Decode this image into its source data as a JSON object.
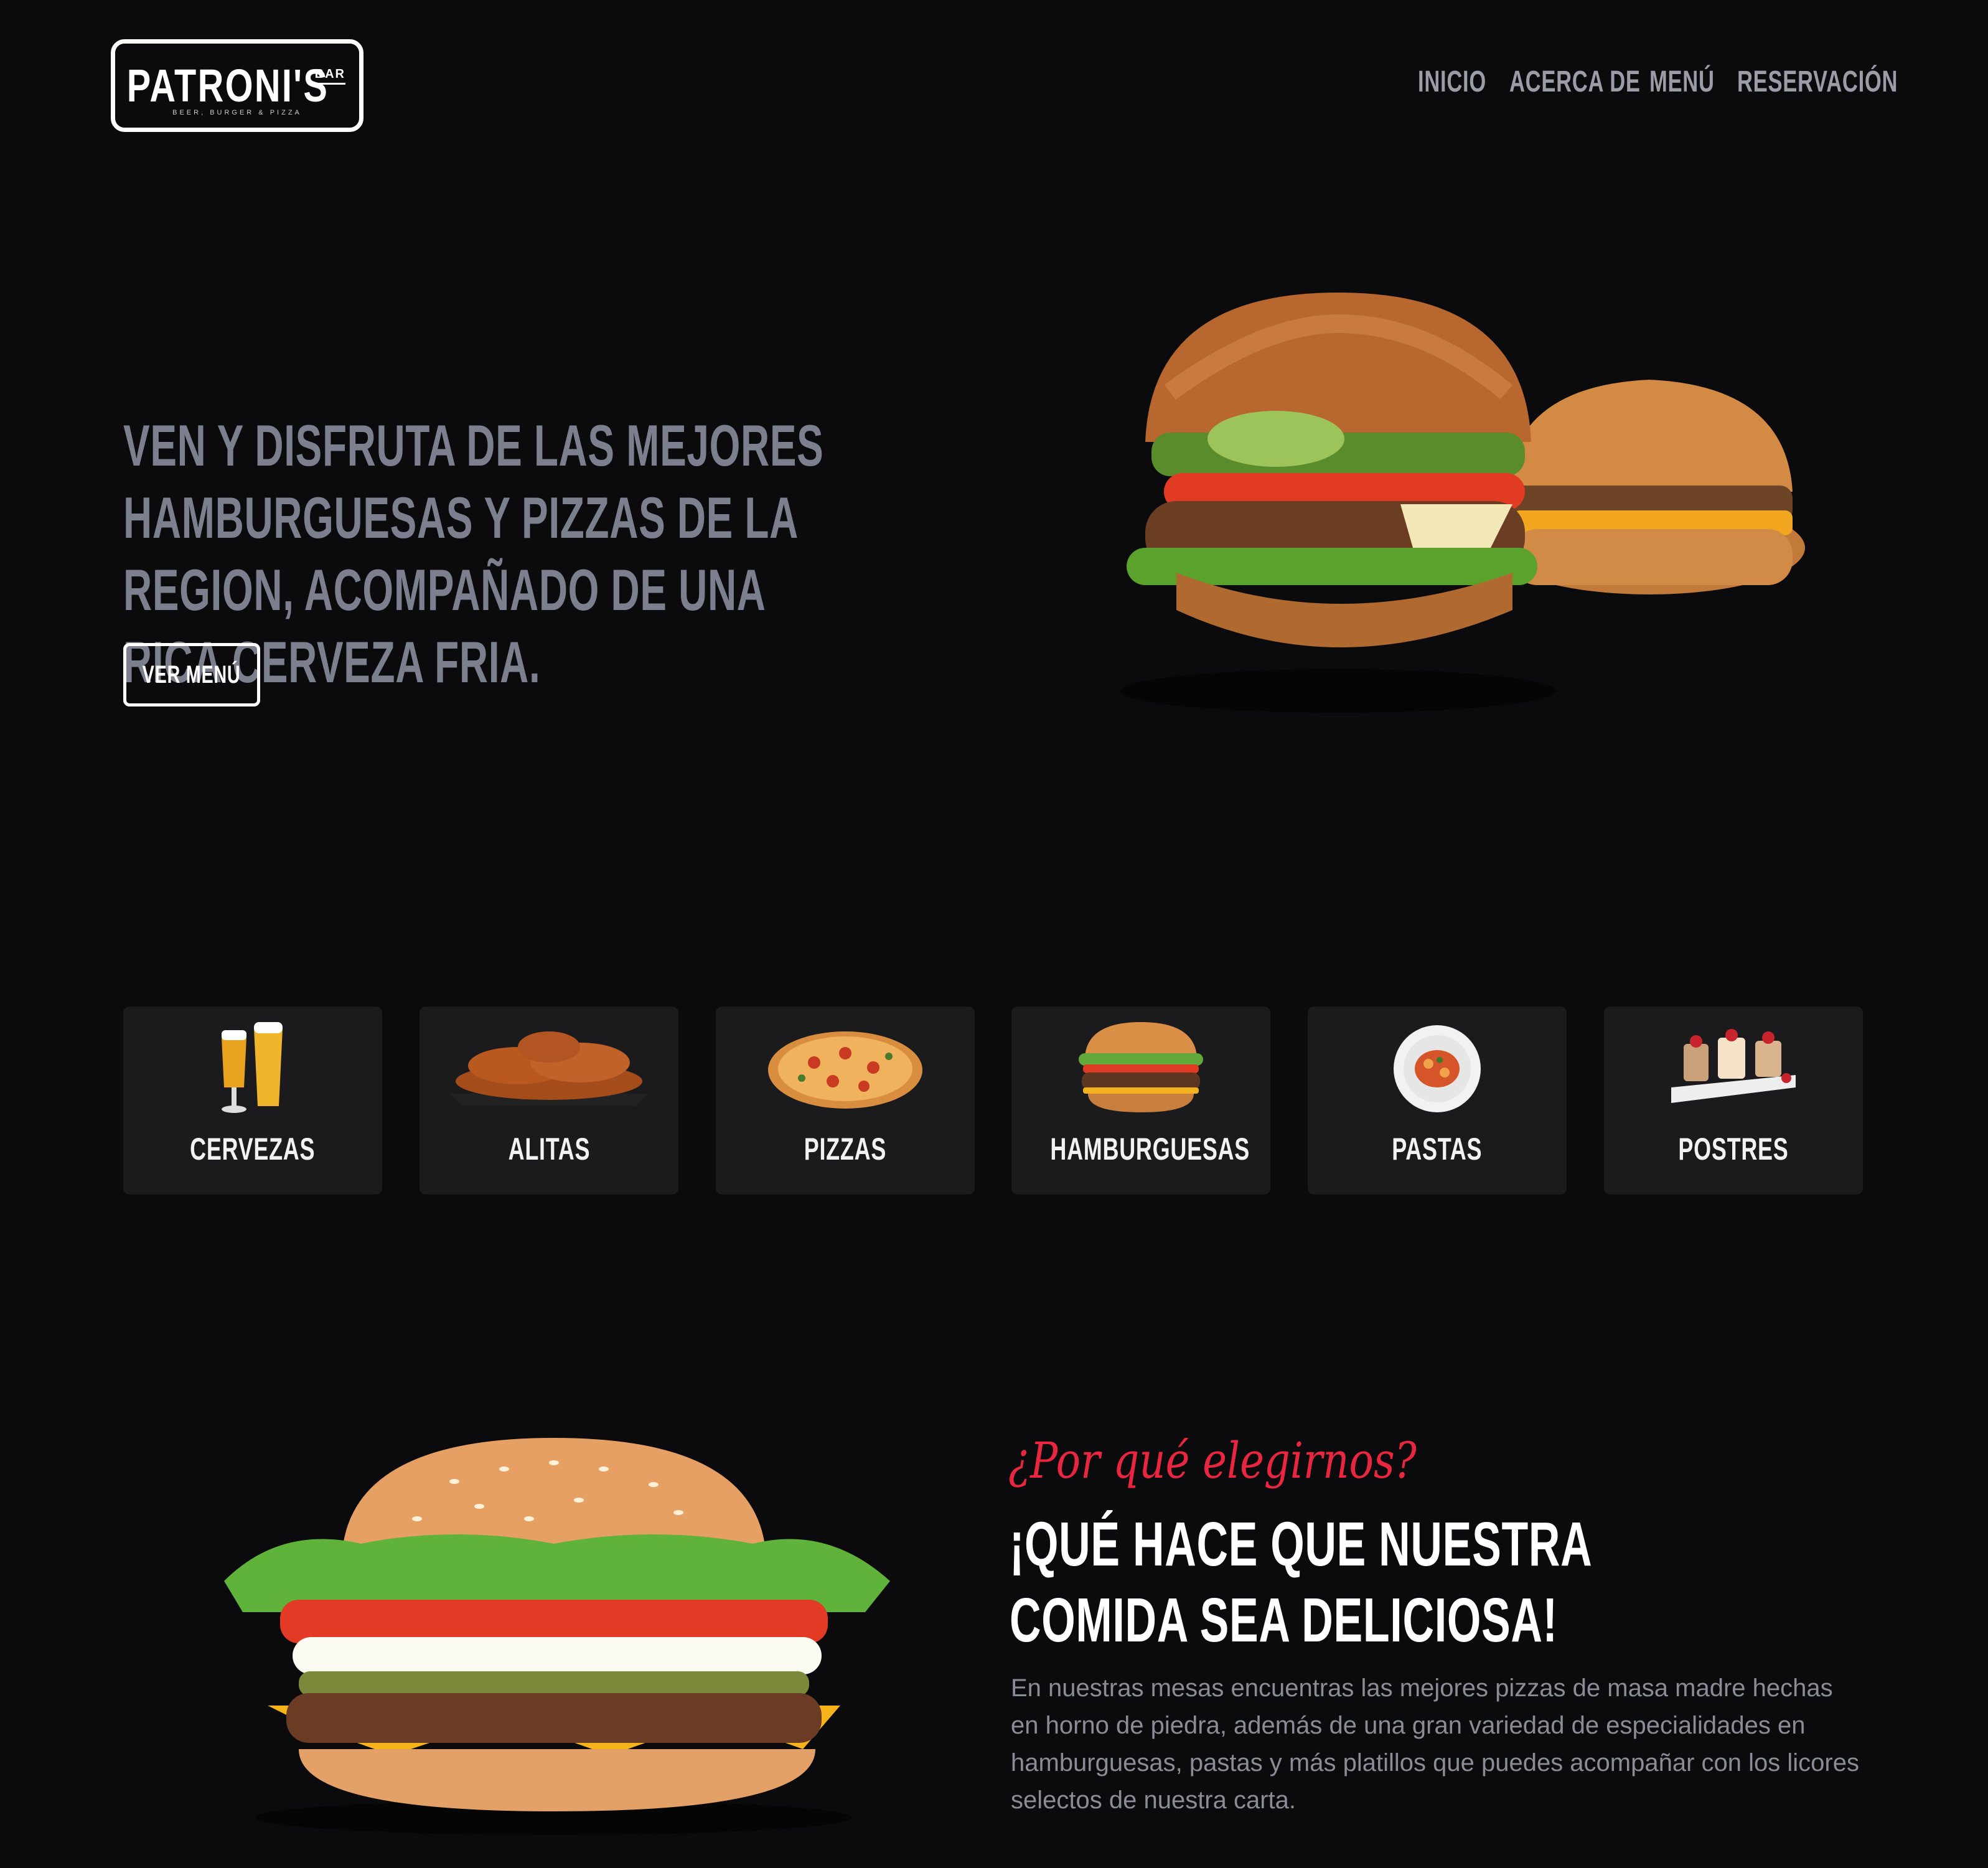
{
  "brand": {
    "name": "PATRONI'S",
    "badge": "BAR",
    "tagline": "BEER, BURGER & PIZZA"
  },
  "nav": {
    "items": [
      "INICIO",
      "ACERCA DE",
      "MENÚ",
      "RESERVACIÓN"
    ]
  },
  "hero": {
    "headline": "VEN Y DISFRUTA DE LAS MEJORES HAMBURGUESAS Y PIZZAS DE LA REGION, ACOMPAÑADO DE UNA RICA CERVEZA FRIA.",
    "button_label": "VER MENÚ"
  },
  "categories": [
    {
      "label": "CERVEZAS",
      "icon": "beer-glasses-icon"
    },
    {
      "label": "ALITAS",
      "icon": "chicken-wings-icon"
    },
    {
      "label": "PIZZAS",
      "icon": "pizza-icon"
    },
    {
      "label": "HAMBURGUESAS",
      "icon": "hamburger-icon"
    },
    {
      "label": "PASTAS",
      "icon": "pasta-plate-icon"
    },
    {
      "label": "POSTRES",
      "icon": "dessert-icon"
    }
  ],
  "about": {
    "kicker": "¿Por qué elegirnos?",
    "title": "¡QUÉ HACE QUE NUESTRA COMIDA SEA DELICIOSA!",
    "body": "En nuestras mesas encuentras las mejores pizzas de masa madre hechas en horno de piedra, además de una gran variedad de especialidades en hamburguesas, pastas y más platillos que puedes acompañar con los licores selectos de nuestra carta."
  },
  "colors": {
    "background": "#0b0b0d",
    "card": "#1b1b1e",
    "accent": "#e8263f",
    "muted_text": "#7b7f8e"
  }
}
